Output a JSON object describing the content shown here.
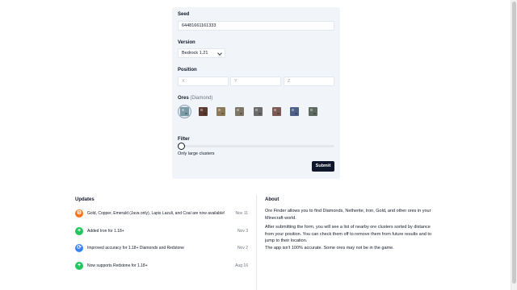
{
  "form": {
    "seed_label": "Seed",
    "seed_value": "64481661161333",
    "version_label": "Version",
    "version_value": "Bedrock 1.21",
    "position_label": "Position",
    "x_placeholder": "X",
    "y_placeholder": "Y",
    "z_placeholder": "Z",
    "ores_label": "Ores",
    "ores_selected_hint": "(Diamond)",
    "ores": [
      {
        "name": "diamond",
        "color": "#7a9aa6",
        "selected": true
      },
      {
        "name": "netherite",
        "color": "#5a3a30",
        "selected": false
      },
      {
        "name": "gold",
        "color": "#8a7a5a",
        "selected": false
      },
      {
        "name": "iron",
        "color": "#7d7566",
        "selected": false
      },
      {
        "name": "coal",
        "color": "#6b6b6b",
        "selected": false
      },
      {
        "name": "copper",
        "color": "#7a5a52",
        "selected": false
      },
      {
        "name": "lapis",
        "color": "#4d5f86",
        "selected": false
      },
      {
        "name": "emerald",
        "color": "#5e6a5e",
        "selected": false
      }
    ],
    "filter_label": "Filter",
    "filter_text": "Only large clusters",
    "submit_label": "Submit"
  },
  "updates": {
    "title": "Updates",
    "items": [
      {
        "icon": "gear-icon",
        "color": "#f97316",
        "glyph": "⚙",
        "text": "Gold, Copper, Emerald (Java only), Lapis Lazuli, and Coal are now available!",
        "date": "Nov 11"
      },
      {
        "icon": "plus-icon",
        "color": "#22c55e",
        "glyph": "+",
        "text": "Added Iron for 1.18+",
        "date": "Nov 3"
      },
      {
        "icon": "refresh-icon",
        "color": "#3b82f6",
        "glyph": "⟳",
        "text": "Improved accuracy for 1.18+ Diamonds and Redstone",
        "date": "Nov 2"
      },
      {
        "icon": "plus-icon",
        "color": "#22c55e",
        "glyph": "+",
        "text": "Now supports Redstone for 1.18+",
        "date": "Aug 16"
      }
    ]
  },
  "about": {
    "title": "About",
    "p1": "Ore Finder allows you to find Diamonds, Netherite, Iron, Gold, and other ores in your Minecraft world.",
    "p2": "After submitting the form, you will see a list of nearby ore clusters sorted by distance from your position. You can check them off to remove them from future results and to jump to their location.",
    "p3": "The app isn't 100% accurate. Some ores may not be in the game."
  }
}
